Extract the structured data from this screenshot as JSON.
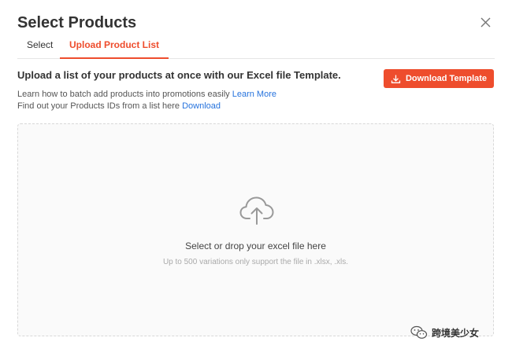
{
  "dialog": {
    "title": "Select Products",
    "close_icon": "close-icon"
  },
  "tabs": [
    {
      "label": "Select",
      "active": false
    },
    {
      "label": "Upload Product List",
      "active": true
    }
  ],
  "upload": {
    "heading": "Upload a list of your products at once with our Excel file Template.",
    "download_template_label": "Download Template",
    "download_template_icon": "download-icon",
    "learn_text": "Learn how to batch add products into promotions easily",
    "learn_link": "Learn More",
    "ids_text": "Find out your Products IDs from a list here",
    "ids_link": "Download"
  },
  "dropzone": {
    "icon": "cloud-upload-icon",
    "main_text": "Select or drop your excel file here",
    "sub_text": "Up to 500 variations only support the file in .xlsx, .xls."
  },
  "watermark": {
    "text": "跨境美少女"
  },
  "colors": {
    "accent": "#ee4d2d",
    "link": "#2673dd"
  }
}
